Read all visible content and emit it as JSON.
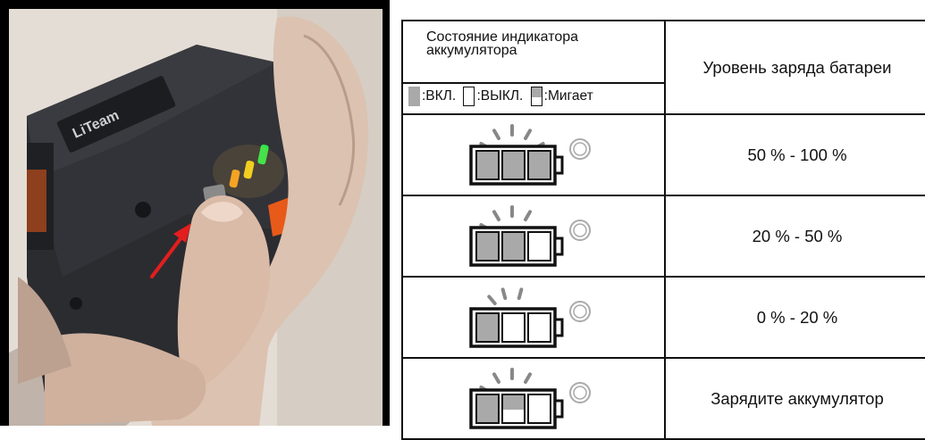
{
  "legend": {
    "header_title": "Состояние индикатора аккумулятора",
    "on_label": ":ВКЛ.",
    "off_label": ":ВЫКЛ.",
    "blink_label": ":Мигает",
    "level_header": "Уровень заряда батареи"
  },
  "rows": [
    {
      "segments": [
        "on",
        "on",
        "on"
      ],
      "rays": 5,
      "level": "50 % - 100 %"
    },
    {
      "segments": [
        "on",
        "on",
        "off"
      ],
      "rays": 4,
      "level": "20 % - 50 %"
    },
    {
      "segments": [
        "on",
        "off",
        "off"
      ],
      "rays": 3,
      "level": "0 % - 20 %"
    },
    {
      "segments": [
        "on",
        "blink",
        "off"
      ],
      "rays": 4,
      "level": "Зарядите аккумулятор"
    }
  ],
  "colors": {
    "segment_on": "#a9a9a9",
    "led_green": "#2ee84a",
    "led_yellow": "#f2d21b",
    "led_orange": "#f5a020",
    "arrow": "#e31e1e",
    "battery_body": "#2b2c30",
    "accent_orange": "#e85a1a"
  }
}
